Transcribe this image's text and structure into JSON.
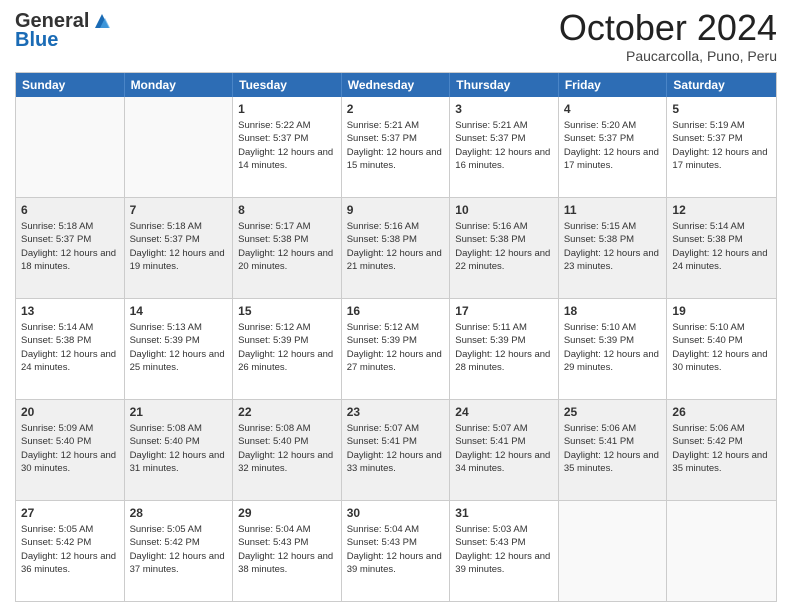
{
  "header": {
    "logo": {
      "line1": "General",
      "line2": "Blue"
    },
    "title": "October 2024",
    "location": "Paucarcolla, Puno, Peru"
  },
  "weekdays": [
    "Sunday",
    "Monday",
    "Tuesday",
    "Wednesday",
    "Thursday",
    "Friday",
    "Saturday"
  ],
  "weeks": [
    [
      {
        "day": "",
        "info": "",
        "empty": true
      },
      {
        "day": "",
        "info": "",
        "empty": true
      },
      {
        "day": "1",
        "info": "Sunrise: 5:22 AM\nSunset: 5:37 PM\nDaylight: 12 hours and 14 minutes.",
        "shaded": false
      },
      {
        "day": "2",
        "info": "Sunrise: 5:21 AM\nSunset: 5:37 PM\nDaylight: 12 hours and 15 minutes.",
        "shaded": false
      },
      {
        "day": "3",
        "info": "Sunrise: 5:21 AM\nSunset: 5:37 PM\nDaylight: 12 hours and 16 minutes.",
        "shaded": false
      },
      {
        "day": "4",
        "info": "Sunrise: 5:20 AM\nSunset: 5:37 PM\nDaylight: 12 hours and 17 minutes.",
        "shaded": false
      },
      {
        "day": "5",
        "info": "Sunrise: 5:19 AM\nSunset: 5:37 PM\nDaylight: 12 hours and 17 minutes.",
        "shaded": false
      }
    ],
    [
      {
        "day": "6",
        "info": "Sunrise: 5:18 AM\nSunset: 5:37 PM\nDaylight: 12 hours and 18 minutes.",
        "shaded": true
      },
      {
        "day": "7",
        "info": "Sunrise: 5:18 AM\nSunset: 5:37 PM\nDaylight: 12 hours and 19 minutes.",
        "shaded": true
      },
      {
        "day": "8",
        "info": "Sunrise: 5:17 AM\nSunset: 5:38 PM\nDaylight: 12 hours and 20 minutes.",
        "shaded": true
      },
      {
        "day": "9",
        "info": "Sunrise: 5:16 AM\nSunset: 5:38 PM\nDaylight: 12 hours and 21 minutes.",
        "shaded": true
      },
      {
        "day": "10",
        "info": "Sunrise: 5:16 AM\nSunset: 5:38 PM\nDaylight: 12 hours and 22 minutes.",
        "shaded": true
      },
      {
        "day": "11",
        "info": "Sunrise: 5:15 AM\nSunset: 5:38 PM\nDaylight: 12 hours and 23 minutes.",
        "shaded": true
      },
      {
        "day": "12",
        "info": "Sunrise: 5:14 AM\nSunset: 5:38 PM\nDaylight: 12 hours and 24 minutes.",
        "shaded": true
      }
    ],
    [
      {
        "day": "13",
        "info": "Sunrise: 5:14 AM\nSunset: 5:38 PM\nDaylight: 12 hours and 24 minutes.",
        "shaded": false
      },
      {
        "day": "14",
        "info": "Sunrise: 5:13 AM\nSunset: 5:39 PM\nDaylight: 12 hours and 25 minutes.",
        "shaded": false
      },
      {
        "day": "15",
        "info": "Sunrise: 5:12 AM\nSunset: 5:39 PM\nDaylight: 12 hours and 26 minutes.",
        "shaded": false
      },
      {
        "day": "16",
        "info": "Sunrise: 5:12 AM\nSunset: 5:39 PM\nDaylight: 12 hours and 27 minutes.",
        "shaded": false
      },
      {
        "day": "17",
        "info": "Sunrise: 5:11 AM\nSunset: 5:39 PM\nDaylight: 12 hours and 28 minutes.",
        "shaded": false
      },
      {
        "day": "18",
        "info": "Sunrise: 5:10 AM\nSunset: 5:39 PM\nDaylight: 12 hours and 29 minutes.",
        "shaded": false
      },
      {
        "day": "19",
        "info": "Sunrise: 5:10 AM\nSunset: 5:40 PM\nDaylight: 12 hours and 30 minutes.",
        "shaded": false
      }
    ],
    [
      {
        "day": "20",
        "info": "Sunrise: 5:09 AM\nSunset: 5:40 PM\nDaylight: 12 hours and 30 minutes.",
        "shaded": true
      },
      {
        "day": "21",
        "info": "Sunrise: 5:08 AM\nSunset: 5:40 PM\nDaylight: 12 hours and 31 minutes.",
        "shaded": true
      },
      {
        "day": "22",
        "info": "Sunrise: 5:08 AM\nSunset: 5:40 PM\nDaylight: 12 hours and 32 minutes.",
        "shaded": true
      },
      {
        "day": "23",
        "info": "Sunrise: 5:07 AM\nSunset: 5:41 PM\nDaylight: 12 hours and 33 minutes.",
        "shaded": true
      },
      {
        "day": "24",
        "info": "Sunrise: 5:07 AM\nSunset: 5:41 PM\nDaylight: 12 hours and 34 minutes.",
        "shaded": true
      },
      {
        "day": "25",
        "info": "Sunrise: 5:06 AM\nSunset: 5:41 PM\nDaylight: 12 hours and 35 minutes.",
        "shaded": true
      },
      {
        "day": "26",
        "info": "Sunrise: 5:06 AM\nSunset: 5:42 PM\nDaylight: 12 hours and 35 minutes.",
        "shaded": true
      }
    ],
    [
      {
        "day": "27",
        "info": "Sunrise: 5:05 AM\nSunset: 5:42 PM\nDaylight: 12 hours and 36 minutes.",
        "shaded": false
      },
      {
        "day": "28",
        "info": "Sunrise: 5:05 AM\nSunset: 5:42 PM\nDaylight: 12 hours and 37 minutes.",
        "shaded": false
      },
      {
        "day": "29",
        "info": "Sunrise: 5:04 AM\nSunset: 5:43 PM\nDaylight: 12 hours and 38 minutes.",
        "shaded": false
      },
      {
        "day": "30",
        "info": "Sunrise: 5:04 AM\nSunset: 5:43 PM\nDaylight: 12 hours and 39 minutes.",
        "shaded": false
      },
      {
        "day": "31",
        "info": "Sunrise: 5:03 AM\nSunset: 5:43 PM\nDaylight: 12 hours and 39 minutes.",
        "shaded": false
      },
      {
        "day": "",
        "info": "",
        "empty": true
      },
      {
        "day": "",
        "info": "",
        "empty": true
      }
    ]
  ]
}
